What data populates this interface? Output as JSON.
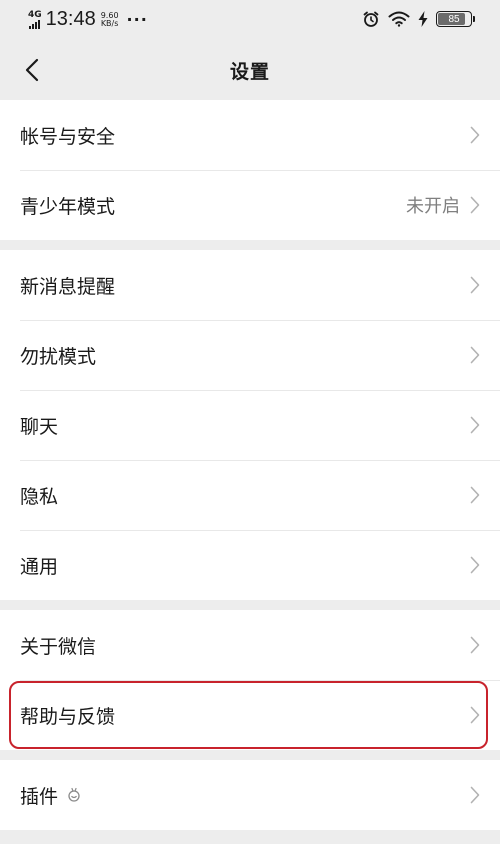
{
  "status_bar": {
    "network": "4G",
    "time": "13:48",
    "speed_value": "9.60",
    "speed_unit": "KB/s",
    "more": "···",
    "battery_level": "85",
    "battery_fraction": 0.85
  },
  "nav": {
    "title": "设置"
  },
  "groups": [
    {
      "items": [
        {
          "label": "帐号与安全"
        },
        {
          "label": "青少年模式",
          "value": "未开启"
        }
      ]
    },
    {
      "items": [
        {
          "label": "新消息提醒"
        },
        {
          "label": "勿扰模式"
        },
        {
          "label": "聊天"
        },
        {
          "label": "隐私"
        },
        {
          "label": "通用"
        }
      ]
    },
    {
      "items": [
        {
          "label": "关于微信"
        },
        {
          "label": "帮助与反馈"
        }
      ]
    },
    {
      "items": [
        {
          "label": "插件"
        }
      ]
    }
  ],
  "icons": {
    "back": "chevron-left-icon",
    "row_arrow": "chevron-right-icon",
    "plugin": "plugin-icon",
    "alarm": "alarm-icon",
    "wifi": "wifi-icon",
    "charging": "charging-icon"
  },
  "colors": {
    "background": "#ededed",
    "surface": "#ffffff",
    "secondary_text": "#808080",
    "highlight_border": "#c8232c"
  }
}
